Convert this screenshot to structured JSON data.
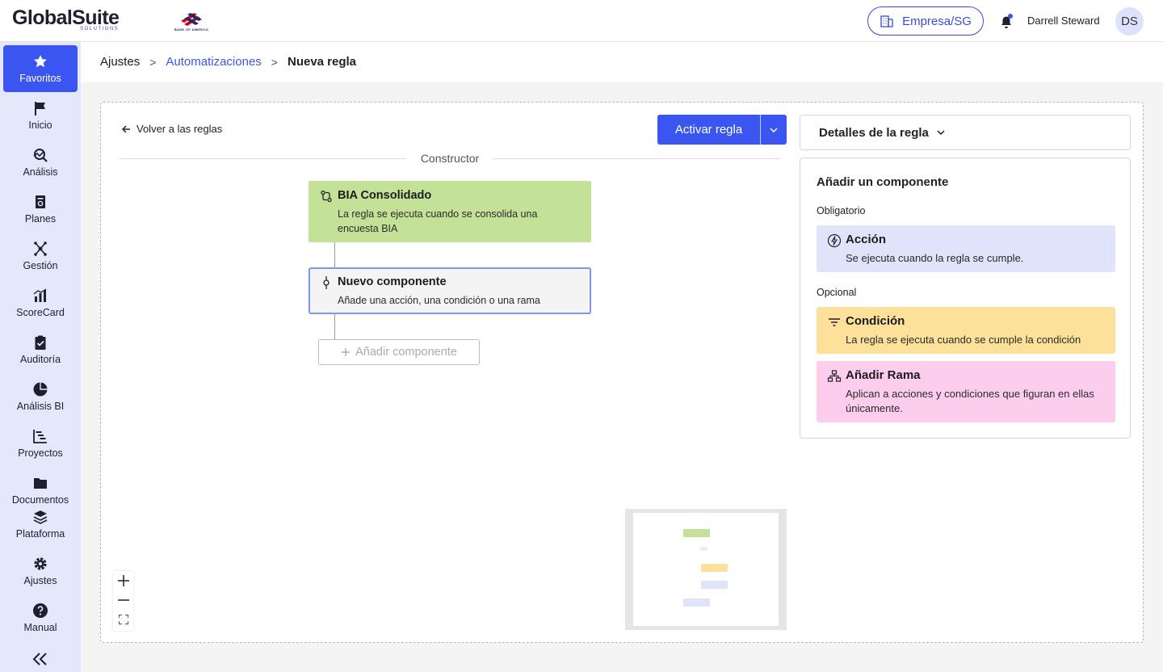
{
  "header": {
    "logo_text": "GlobalSuite",
    "logo_sub": "SOLUTIONS",
    "partner_logo_text": "BANK OF AMERICA",
    "company_label": "Empresa/SG",
    "user_name": "Darrell Steward",
    "user_initials": "DS"
  },
  "sidebar": {
    "items": [
      {
        "label": "Favoritos",
        "icon": "star-icon"
      },
      {
        "label": "Inicio",
        "icon": "flag-icon"
      },
      {
        "label": "Análisis",
        "icon": "analysis-icon"
      },
      {
        "label": "Planes",
        "icon": "planes-icon"
      },
      {
        "label": "Gestión",
        "icon": "network-icon"
      },
      {
        "label": "ScoreCard",
        "icon": "bar-chart-icon"
      },
      {
        "label": "Auditoría",
        "icon": "clipboard-check-icon"
      },
      {
        "label": "Análisis BI",
        "icon": "pie-chart-icon"
      },
      {
        "label": "Proyectos",
        "icon": "gantt-icon"
      },
      {
        "label": "Documentos",
        "icon": "folder-icon"
      },
      {
        "label": "Plataforma",
        "icon": "layers-icon"
      },
      {
        "label": "Ajustes",
        "icon": "gear-icon"
      },
      {
        "label": "Manual",
        "icon": "help-icon"
      }
    ],
    "active_index": 0
  },
  "breadcrumb": {
    "root": "Ajustes",
    "parent": "Automatizaciones",
    "current": "Nueva regla"
  },
  "builder": {
    "back_label": "Volver a las reglas",
    "activate_label": "Activar regla",
    "section_label": "Constructor",
    "trigger": {
      "title": "BIA Consolidado",
      "description": "La regla se ejecuta cuando se consolida una encuesta BIA"
    },
    "new_component": {
      "title": "Nuevo componente",
      "description": "Añade una acción, una condición o una rama"
    },
    "add_component_label": "Añadir componente"
  },
  "panel": {
    "details_label": "Detalles de la regla",
    "title": "Añadir un componente",
    "required_label": "Obligatorio",
    "optional_label": "Opcional",
    "cards": {
      "action": {
        "title": "Acción",
        "description": "Se ejecuta cuando la regla se cumple."
      },
      "condition": {
        "title": "Condición",
        "description": "La regla se ejecuta cuando se cumple la condición"
      },
      "branch": {
        "title": "Añadir Rama",
        "description": "Aplican a acciones y condiciones que figuran en ellas únicamente."
      }
    }
  },
  "colors": {
    "accent": "#3a55f0",
    "sidebar_bg": "#e3e8fb",
    "trigger_green": "#c3e297",
    "action_blue": "#dfe4fb",
    "condition_yellow": "#fde19a",
    "branch_pink": "#fdcdee"
  }
}
